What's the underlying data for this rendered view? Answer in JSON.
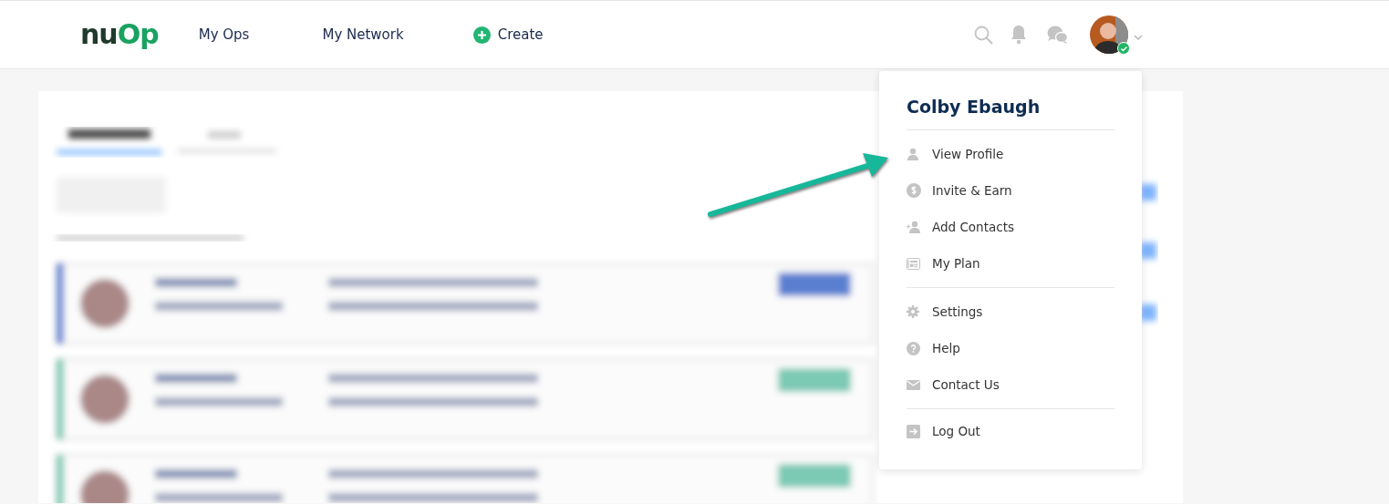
{
  "header": {
    "logo": [
      {
        "text": "nu",
        "color": "#1e3a2c"
      },
      {
        "text": "Op",
        "color": "#1aa260"
      }
    ],
    "nav": [
      {
        "label": "My Ops",
        "kind": "link"
      },
      {
        "label": "My Network",
        "kind": "link"
      },
      {
        "label": "Create",
        "kind": "create"
      }
    ],
    "avatar": {
      "online": true
    }
  },
  "user_menu": {
    "user_name": "Colby Ebaugh",
    "groups": [
      [
        {
          "label": "View Profile",
          "kind": "person"
        },
        {
          "label": "Invite & Earn",
          "kind": "dollar"
        },
        {
          "label": "Add Contacts",
          "kind": "add-person"
        },
        {
          "label": "My Plan",
          "kind": "plan"
        }
      ],
      [
        {
          "label": "Settings",
          "kind": "gear"
        },
        {
          "label": "Help",
          "kind": "help"
        },
        {
          "label": "Contact Us",
          "kind": "mail"
        }
      ],
      [
        {
          "label": "Log Out",
          "kind": "logout"
        }
      ]
    ]
  }
}
